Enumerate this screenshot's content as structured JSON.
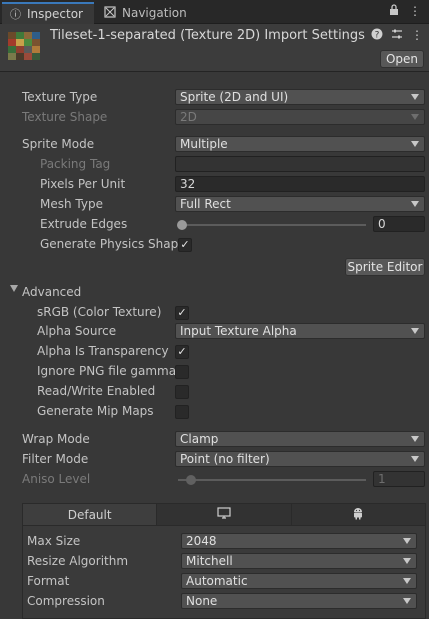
{
  "tabs": {
    "inspector": {
      "label": "Inspector",
      "icon": "info-icon"
    },
    "navigation": {
      "label": "Navigation",
      "icon": "navigation-icon"
    }
  },
  "header": {
    "title": "Tileset-1-separated (Texture 2D) Import Settings",
    "open_label": "Open"
  },
  "fields": {
    "texture_type": {
      "label": "Texture Type",
      "value": "Sprite (2D and UI)"
    },
    "texture_shape": {
      "label": "Texture Shape",
      "value": "2D"
    },
    "sprite_mode": {
      "label": "Sprite Mode",
      "value": "Multiple"
    },
    "packing_tag": {
      "label": "Packing Tag",
      "value": ""
    },
    "pixels_per_unit": {
      "label": "Pixels Per Unit",
      "value": "32"
    },
    "mesh_type": {
      "label": "Mesh Type",
      "value": "Full Rect"
    },
    "extrude_edges": {
      "label": "Extrude Edges",
      "value": "0"
    },
    "generate_physics_shape": {
      "label": "Generate Physics Shape",
      "checked": true
    },
    "sprite_editor": {
      "label": "Sprite Editor"
    }
  },
  "advanced": {
    "label": "Advanced",
    "srgb": {
      "label": "sRGB (Color Texture)",
      "checked": true
    },
    "alpha_source": {
      "label": "Alpha Source",
      "value": "Input Texture Alpha"
    },
    "alpha_is_transparency": {
      "label": "Alpha Is Transparency",
      "checked": true
    },
    "ignore_png_gamma": {
      "label": "Ignore PNG file gamma",
      "checked": false
    },
    "read_write": {
      "label": "Read/Write Enabled",
      "checked": false
    },
    "generate_mip_maps": {
      "label": "Generate Mip Maps",
      "checked": false
    }
  },
  "wrap_mode": {
    "label": "Wrap Mode",
    "value": "Clamp"
  },
  "filter_mode": {
    "label": "Filter Mode",
    "value": "Point (no filter)"
  },
  "aniso_level": {
    "label": "Aniso Level",
    "value": "1"
  },
  "platform": {
    "tabs": [
      {
        "label": "Default",
        "icon": ""
      },
      {
        "label": "",
        "icon": "monitor-icon"
      },
      {
        "label": "",
        "icon": "android-icon"
      }
    ],
    "max_size": {
      "label": "Max Size",
      "value": "2048"
    },
    "resize_algorithm": {
      "label": "Resize Algorithm",
      "value": "Mitchell"
    },
    "format": {
      "label": "Format",
      "value": "Automatic"
    },
    "compression": {
      "label": "Compression",
      "value": "None"
    }
  },
  "colors": {
    "background": "#383838",
    "tab_accent": "#3a79bb",
    "field_bg": "#515151"
  }
}
